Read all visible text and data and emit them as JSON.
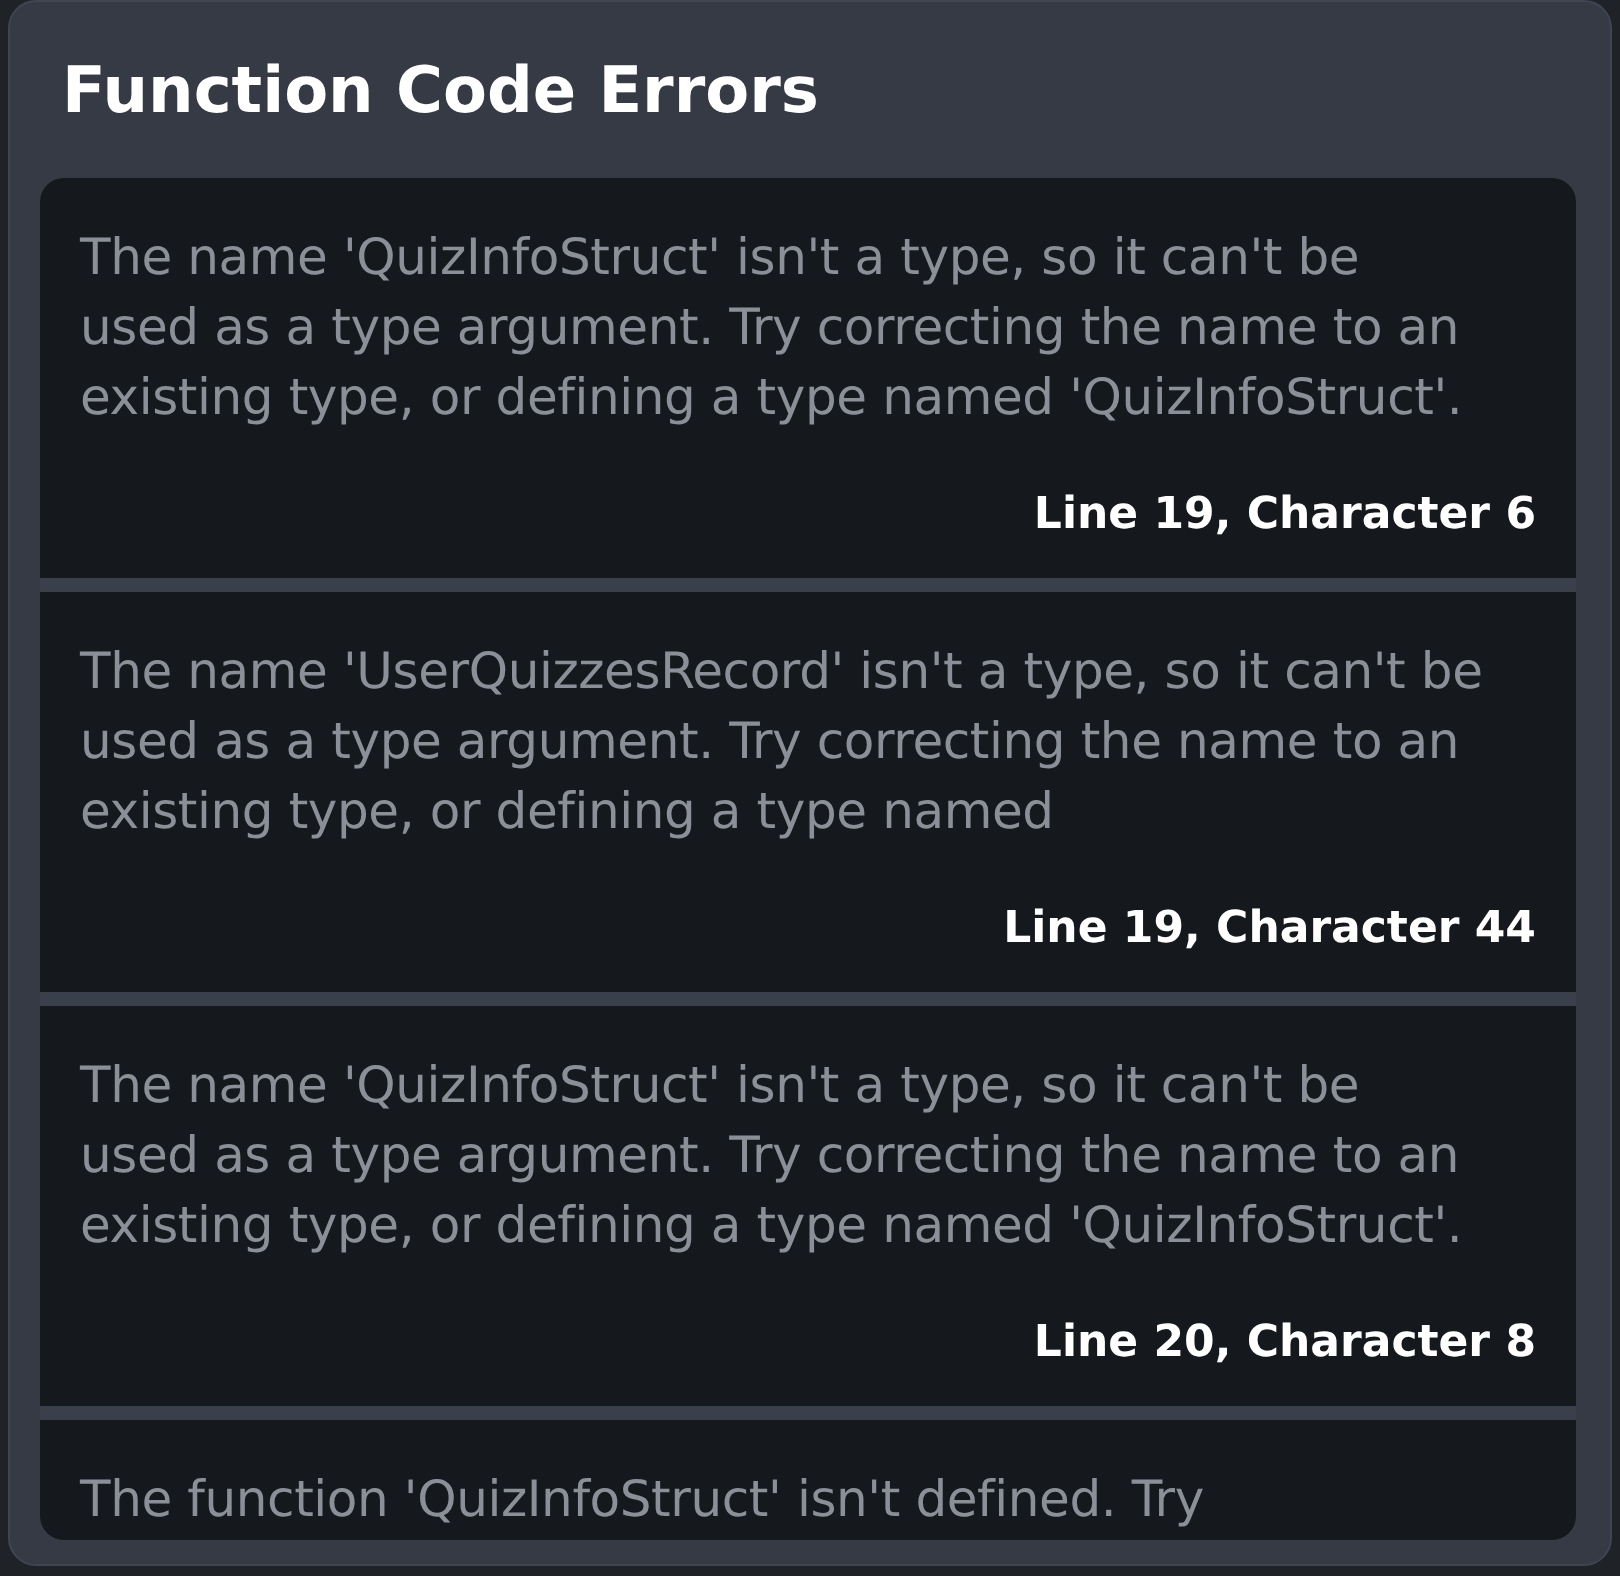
{
  "panel": {
    "title": "Function Code Errors"
  },
  "errors": [
    {
      "message": "The name 'QuizInfoStruct' isn't a type, so it can't be used as a type argument. Try correcting the name to an existing type, or defining a type named 'QuizInfoStruct'.",
      "location": "Line 19, Character 6"
    },
    {
      "message": "The name 'UserQuizzesRecord' isn't a type, so it can't be used as a type argument. Try correcting the name to an existing type, or defining a type named",
      "location": "Line 19, Character 44"
    },
    {
      "message": "The name 'QuizInfoStruct' isn't a type, so it can't be used as a type argument. Try correcting the name to an existing type, or defining a type named 'QuizInfoStruct'.",
      "location": "Line 20, Character 8"
    },
    {
      "message": "The function 'QuizInfoStruct' isn't defined. Try"
    }
  ]
}
